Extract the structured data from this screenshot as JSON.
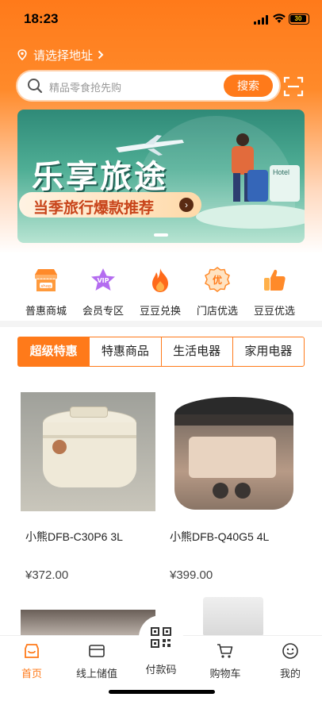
{
  "status_bar": {
    "time": "18:23",
    "battery": "30"
  },
  "address": {
    "label": "请选择地址"
  },
  "search": {
    "placeholder": "精品零食抢先购",
    "button": "搜索"
  },
  "banner": {
    "title": "乐享旅途",
    "subtitle": "当季旅行爆款推荐",
    "hotel_sign": "Hotel",
    "page_dots": 1
  },
  "categories": [
    {
      "label": "普惠商城",
      "icon": "shop-icon"
    },
    {
      "label": "会员专区",
      "icon": "vip-icon"
    },
    {
      "label": "豆豆兑换",
      "icon": "flame-icon"
    },
    {
      "label": "门店优选",
      "icon": "badge-you-icon"
    },
    {
      "label": "豆豆优选",
      "icon": "thumbs-up-icon"
    }
  ],
  "tabs": [
    {
      "label": "超级特惠",
      "active": true
    },
    {
      "label": "特惠商品",
      "active": false
    },
    {
      "label": "生活电器",
      "active": false
    },
    {
      "label": "家用电器",
      "active": false
    }
  ],
  "products": [
    {
      "name": "小熊DFB-C30P6 3L",
      "price": "¥372.00",
      "image": "cream-rice-cooker"
    },
    {
      "name": "小熊DFB-Q40G5 4L",
      "price": "¥399.00",
      "image": "bronze-rice-cooker"
    }
  ],
  "tabbar": [
    {
      "label": "首页",
      "icon": "home-icon",
      "active": true
    },
    {
      "label": "线上储值",
      "icon": "wallet-card-icon",
      "active": false
    },
    {
      "label": "付款码",
      "icon": "qr-code-icon",
      "active": false
    },
    {
      "label": "购物车",
      "icon": "cart-icon",
      "active": false
    },
    {
      "label": "我的",
      "icon": "smiley-icon",
      "active": false
    }
  ],
  "colors": {
    "accent": "#ff7a1a",
    "banner_green": "#3a9a84"
  }
}
